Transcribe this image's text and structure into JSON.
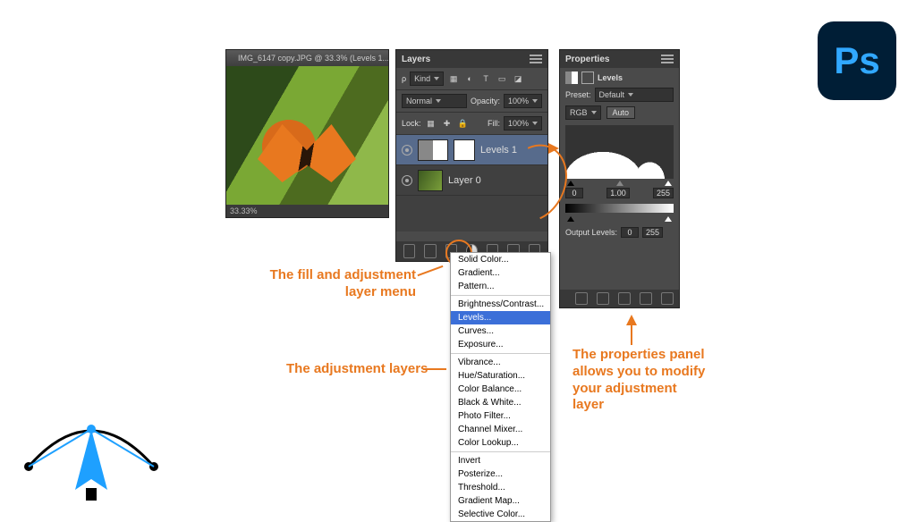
{
  "doc_window": {
    "title": "IMG_6147 copy.JPG @ 33.3% (Levels 1...",
    "zoom": "33.33%"
  },
  "layers_panel": {
    "title": "Layers",
    "filter_label": "Kind",
    "blend_mode": "Normal",
    "opacity_label": "Opacity:",
    "opacity_value": "100%",
    "lock_label": "Lock:",
    "fill_label": "Fill:",
    "fill_value": "100%",
    "layers": [
      {
        "name": "Levels 1"
      },
      {
        "name": "Layer 0"
      }
    ]
  },
  "properties_panel": {
    "title": "Properties",
    "type_label": "Levels",
    "preset_label": "Preset:",
    "preset_value": "Default",
    "channel": "RGB",
    "auto_label": "Auto",
    "input_black": "0",
    "input_mid": "1.00",
    "input_white": "255",
    "output_label": "Output Levels:",
    "output_black": "0",
    "output_white": "255"
  },
  "adj_menu": {
    "items": [
      "Solid Color...",
      "Gradient...",
      "Pattern...",
      "-",
      "Brightness/Contrast...",
      "Levels...",
      "Curves...",
      "Exposure...",
      "-",
      "Vibrance...",
      "Hue/Saturation...",
      "Color Balance...",
      "Black & White...",
      "Photo Filter...",
      "Channel Mixer...",
      "Color Lookup...",
      "-",
      "Invert",
      "Posterize...",
      "Threshold...",
      "Gradient Map...",
      "Selective Color..."
    ],
    "selected": "Levels..."
  },
  "annotations": {
    "fill_adj": "The fill and adjustment layer menu",
    "adj_layers": "The adjustment layers",
    "props": "The properties panel allows you to modify your adjustment layer"
  },
  "ps_logo": "Ps"
}
